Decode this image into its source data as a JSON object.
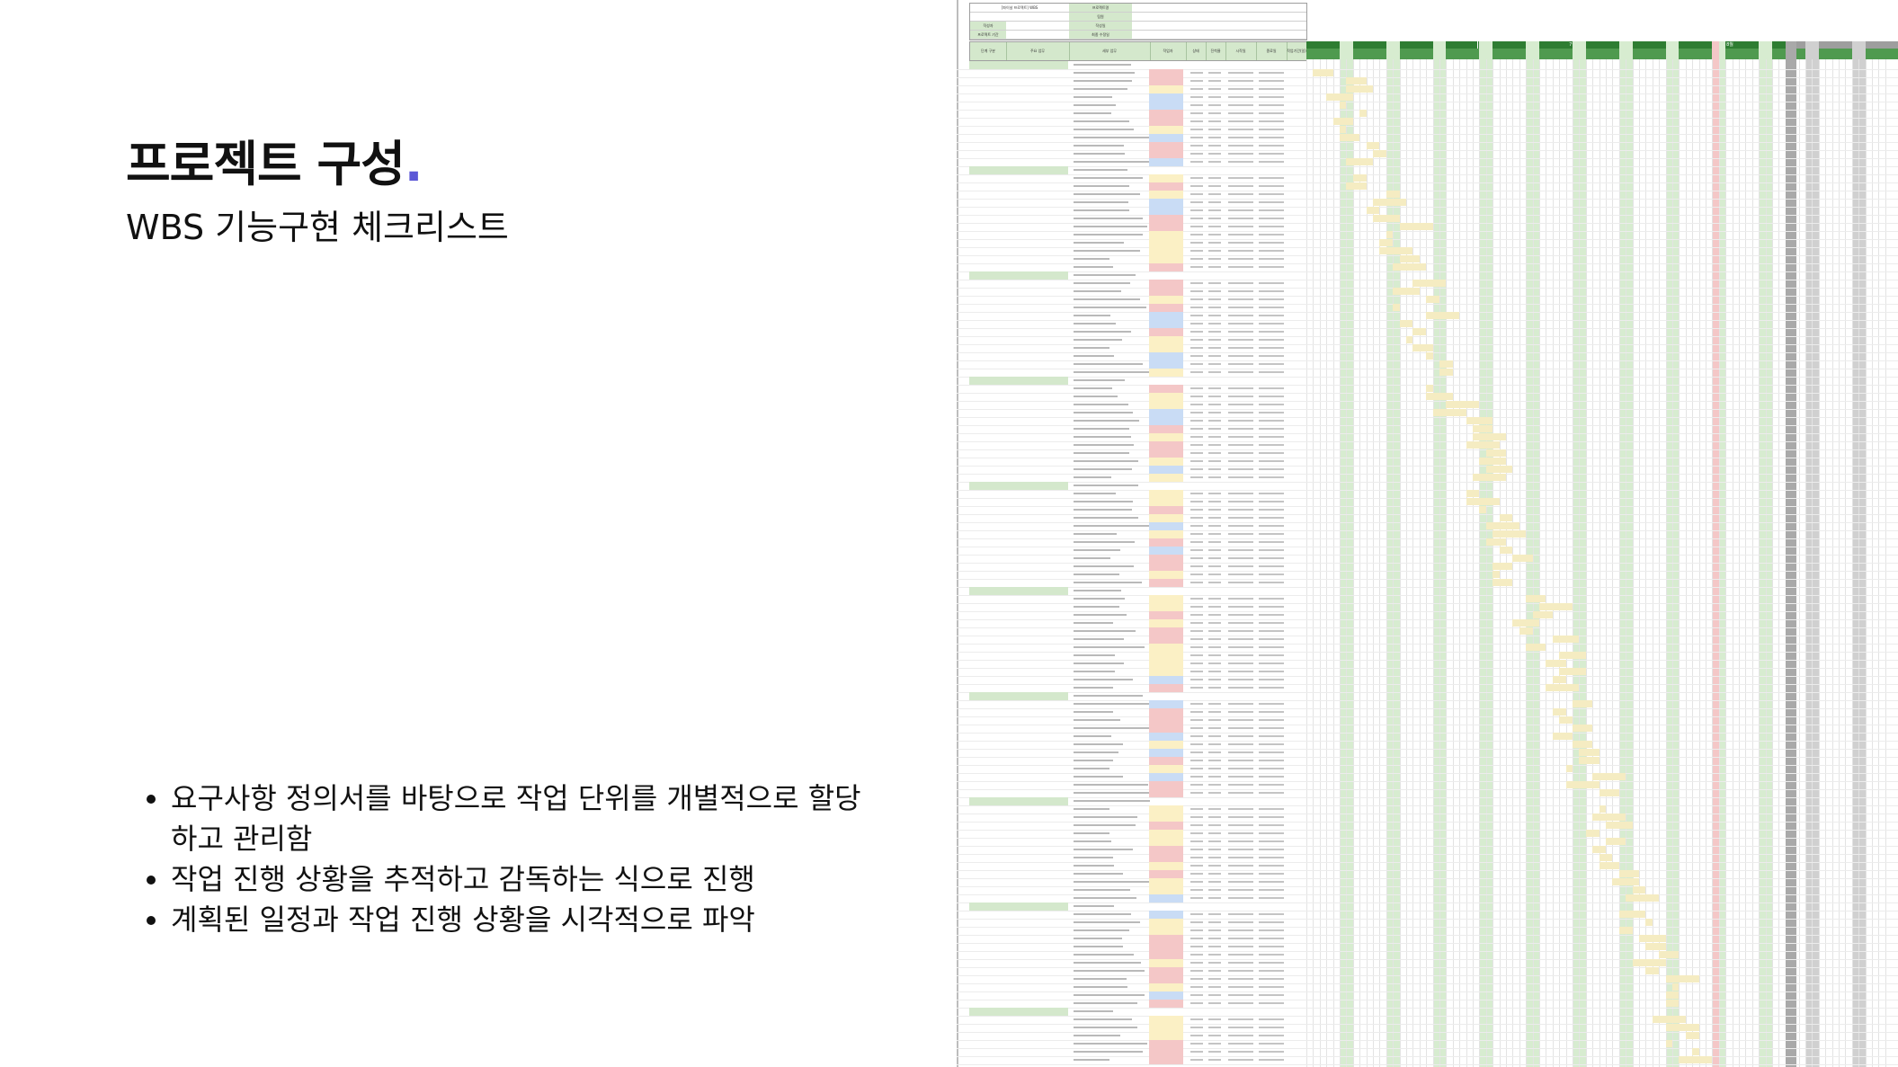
{
  "slide": {
    "title": "프로젝트 구성",
    "title_dot": ".",
    "subtitle": "WBS 기능구현 체크리스트",
    "bullets": [
      "요구사항 정의서를 바탕으로 작업 단위를 개별적으로 할당하고 관리함",
      "작업 진행 상황을 추적하고 감독하는 식으로 진행",
      "계획된 일정과 작업 진행 상황을 시각적으로 파악"
    ]
  },
  "sheet": {
    "info": {
      "project_name": "[파이널 프로젝트] WBS",
      "pm_label": "프로젝트명",
      "writer_label": "작성자",
      "period_label": "프로젝트 기간",
      "team_label": "팀원",
      "date_label": "작성일",
      "last_modified_label": "최종 수정일"
    },
    "headers": [
      "단계 구분",
      "주요 업무",
      "세부 업무",
      "작업자",
      "상태",
      "진척율",
      "시작일",
      "종료일",
      "작업기간(일)"
    ],
    "months": [
      "6월",
      "7월",
      "8월"
    ],
    "colors": {
      "header_green": "#d4e8cc",
      "month_green": "#2e7d32",
      "weekend_green": "#d7ecd0",
      "holiday_red": "#f4c7c7",
      "future_gray": "#bdbdbd",
      "bar_yellow": "#f5ecc2",
      "tag_red": "#f4c7c7",
      "tag_yellow": "#fbf0c5",
      "tag_blue": "#c9dcf5"
    }
  }
}
